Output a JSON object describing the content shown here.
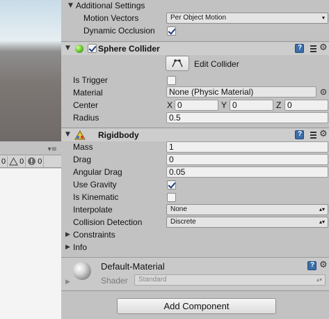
{
  "console": {
    "menu_icon": "dropdown-menu-icon",
    "counts": [
      {
        "icon": "info-speech-icon",
        "value": "0"
      },
      {
        "icon": "warning-triangle-icon",
        "value": "0"
      },
      {
        "icon": "error-circle-icon",
        "value": "0"
      }
    ]
  },
  "additional_settings": {
    "title": "Additional Settings",
    "motion_vectors_label": "Motion Vectors",
    "motion_vectors_value": "Per Object Motion",
    "dynamic_occlusion_label": "Dynamic Occlusion",
    "dynamic_occlusion_checked": true
  },
  "sphere_collider": {
    "title": "Sphere Collider",
    "enabled": true,
    "edit_collider_label": "Edit Collider",
    "is_trigger_label": "Is Trigger",
    "is_trigger_checked": false,
    "material_label": "Material",
    "material_value": "None (Physic Material)",
    "center_label": "Center",
    "center": {
      "x_label": "X",
      "x": "0",
      "y_label": "Y",
      "y": "0",
      "z_label": "Z",
      "z": "0"
    },
    "radius_label": "Radius",
    "radius_value": "0.5"
  },
  "rigidbody": {
    "title": "Rigidbody",
    "mass_label": "Mass",
    "mass_value": "1",
    "drag_label": "Drag",
    "drag_value": "0",
    "angular_drag_label": "Angular Drag",
    "angular_drag_value": "0.05",
    "use_gravity_label": "Use Gravity",
    "use_gravity_checked": true,
    "is_kinematic_label": "Is Kinematic",
    "is_kinematic_checked": false,
    "interpolate_label": "Interpolate",
    "interpolate_value": "None",
    "collision_detection_label": "Collision Detection",
    "collision_detection_value": "Discrete",
    "constraints_label": "Constraints",
    "info_label": "Info"
  },
  "material": {
    "name": "Default-Material",
    "shader_label": "Shader",
    "shader_value": "Standard"
  },
  "add_component_label": "Add Component",
  "colors": {
    "panel_bg": "#c2c2c2",
    "header_bg": "#cdcdcd",
    "checkmark": "#1c3e7c",
    "help_icon": "#3d6ea8"
  }
}
